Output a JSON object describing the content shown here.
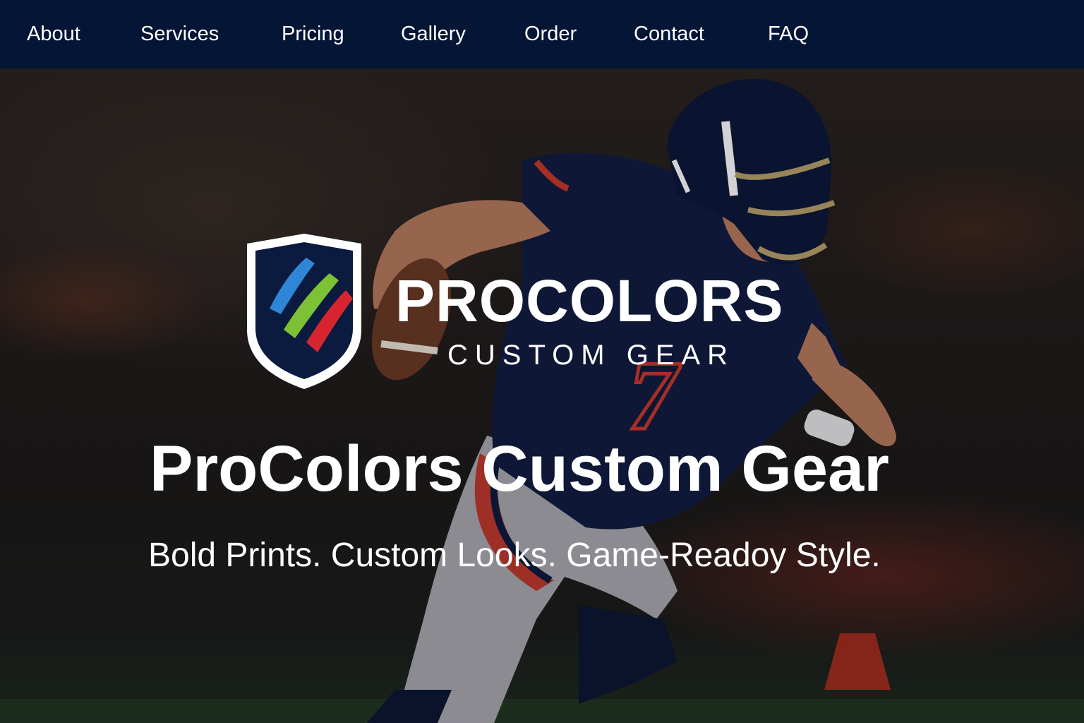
{
  "nav": {
    "items": [
      {
        "label": "About"
      },
      {
        "label": "Services"
      },
      {
        "label": "Pricing"
      },
      {
        "label": "Gallery"
      },
      {
        "label": "Order"
      },
      {
        "label": "Contact"
      },
      {
        "label": "FAQ"
      }
    ]
  },
  "brand": {
    "name": "PROCOLORS",
    "subtitle": "CUSTOM GEAR",
    "logo_stripe_colors": [
      "#2f86d6",
      "#7cc234",
      "#d6252e"
    ]
  },
  "hero": {
    "title": "ProColors Custom Gear",
    "tagline": "Bold Prints. Custom Looks. Game-Readoy Style.",
    "jersey_number": "7"
  },
  "colors": {
    "nav_background": "#041536",
    "navy": "#0a1a3c",
    "accent_red": "#c8382a"
  }
}
